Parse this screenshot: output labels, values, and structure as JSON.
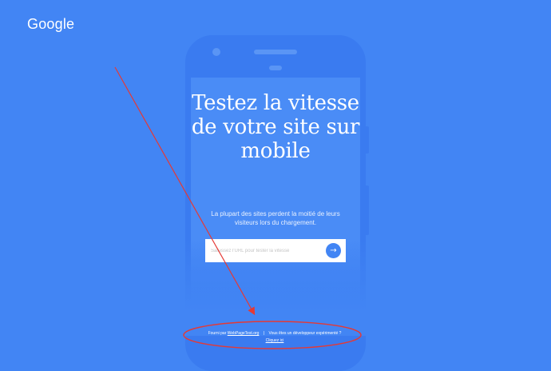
{
  "header": {
    "logo_text": "Google"
  },
  "hero": {
    "headline": "Testez la vitesse de votre site sur mobile",
    "subtitle": "La plupart des sites perdent la moitié de leurs visiteurs lors du chargement."
  },
  "search": {
    "placeholder": "Saisissez l'URL pour tester la vitesse",
    "go_icon": "arrow-right-icon"
  },
  "footer": {
    "powered_prefix": "Fourni par",
    "powered_link": "WebPageTest.org",
    "separator": "|",
    "developer_question": "Vous êtes un développeur expérimenté ?",
    "developer_link": "Cliquez ici"
  },
  "annotation": {
    "color": "#e53935"
  },
  "colors": {
    "background": "#4285f4",
    "phone": "#3a7bf0",
    "accent": "#4285f4"
  }
}
